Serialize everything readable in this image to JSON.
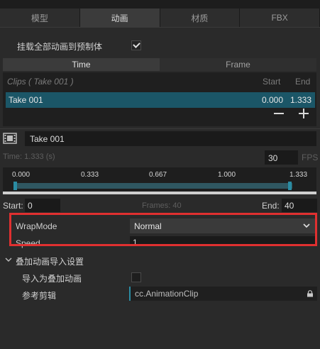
{
  "tabs": [
    "模型",
    "动画",
    "材质",
    "FBX"
  ],
  "mount_all": {
    "label": "挂载全部动画到预制体",
    "checked": true
  },
  "mode_toggle": {
    "time": "Time",
    "frame": "Frame"
  },
  "clips": {
    "header": "Clips ( Take 001 )",
    "start_label": "Start",
    "end_label": "End",
    "rows": [
      {
        "name": "Take 001",
        "start": "0.000",
        "end": "1.333"
      }
    ]
  },
  "clip_editor": {
    "name": "Take 001",
    "time_label": "Time: 1.333 (s)",
    "fps_value": "30",
    "fps_label": "FPS",
    "ticks": [
      "0.000",
      "0.333",
      "0.667",
      "1.000",
      "1.333"
    ],
    "start_label": "Start:",
    "start_value": "0",
    "frames_label": "Frames: 40",
    "end_label": "End:",
    "end_value": "40"
  },
  "wrap_mode": {
    "label": "WrapMode",
    "value": "Normal"
  },
  "speed": {
    "label": "Speed",
    "value": "1"
  },
  "additive": {
    "section": "叠加动画导入设置",
    "import_label": "导入为叠加动画",
    "import_checked": false,
    "ref_label": "参考剪辑",
    "ref_value": "cc.AnimationClip"
  },
  "colors": {
    "accent": "#2a8ca3",
    "selected_row": "#1b5667",
    "highlight_box": "#e03030"
  }
}
